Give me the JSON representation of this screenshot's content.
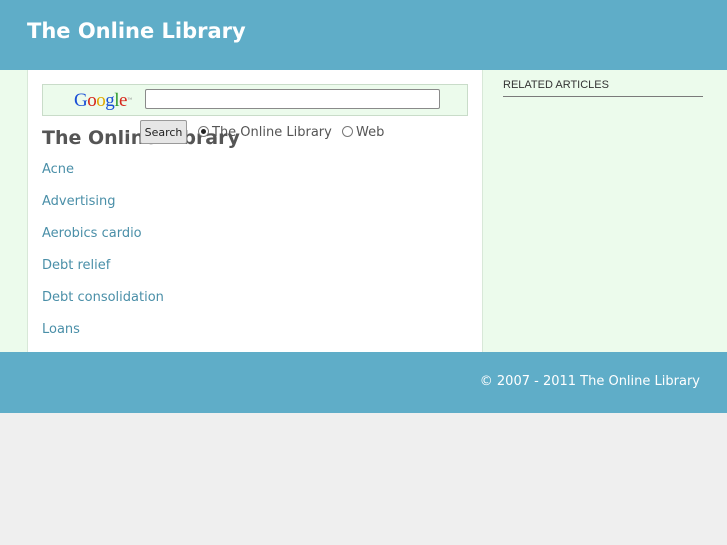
{
  "header": {
    "site_title": "The Online Library"
  },
  "search": {
    "logo_text": "Google",
    "logo_trademark": "™",
    "input_value": "",
    "button_label": "Search",
    "options": [
      {
        "label": "The Online Library",
        "checked": true
      },
      {
        "label": "Web",
        "checked": false
      }
    ]
  },
  "main": {
    "heading": "The Online Library",
    "links": [
      {
        "label": "Acne"
      },
      {
        "label": "Advertising"
      },
      {
        "label": "Aerobics cardio"
      },
      {
        "label": "Debt relief"
      },
      {
        "label": "Debt consolidation"
      },
      {
        "label": "Loans"
      }
    ]
  },
  "sidebar": {
    "title": "RELATED ARTICLES"
  },
  "footer": {
    "copyright": "© 2007 - 2011 The Online Library"
  },
  "colors": {
    "header_bg": "#5fadc8",
    "content_bg": "#ecfbec",
    "link": "#4a8fa8",
    "page_bg": "#efefef"
  }
}
